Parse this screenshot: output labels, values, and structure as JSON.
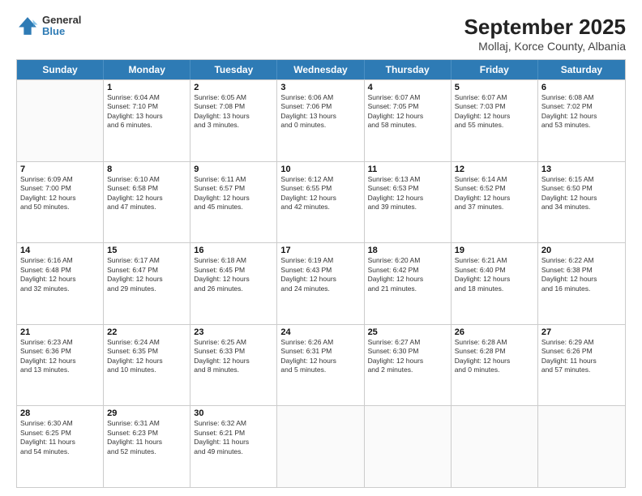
{
  "header": {
    "logo_line1": "General",
    "logo_line2": "Blue",
    "title": "September 2025",
    "subtitle": "Mollaj, Korce County, Albania"
  },
  "weekdays": [
    "Sunday",
    "Monday",
    "Tuesday",
    "Wednesday",
    "Thursday",
    "Friday",
    "Saturday"
  ],
  "weeks": [
    [
      {
        "day": "",
        "detail": ""
      },
      {
        "day": "1",
        "detail": "Sunrise: 6:04 AM\nSunset: 7:10 PM\nDaylight: 13 hours\nand 6 minutes."
      },
      {
        "day": "2",
        "detail": "Sunrise: 6:05 AM\nSunset: 7:08 PM\nDaylight: 13 hours\nand 3 minutes."
      },
      {
        "day": "3",
        "detail": "Sunrise: 6:06 AM\nSunset: 7:06 PM\nDaylight: 13 hours\nand 0 minutes."
      },
      {
        "day": "4",
        "detail": "Sunrise: 6:07 AM\nSunset: 7:05 PM\nDaylight: 12 hours\nand 58 minutes."
      },
      {
        "day": "5",
        "detail": "Sunrise: 6:07 AM\nSunset: 7:03 PM\nDaylight: 12 hours\nand 55 minutes."
      },
      {
        "day": "6",
        "detail": "Sunrise: 6:08 AM\nSunset: 7:02 PM\nDaylight: 12 hours\nand 53 minutes."
      }
    ],
    [
      {
        "day": "7",
        "detail": "Sunrise: 6:09 AM\nSunset: 7:00 PM\nDaylight: 12 hours\nand 50 minutes."
      },
      {
        "day": "8",
        "detail": "Sunrise: 6:10 AM\nSunset: 6:58 PM\nDaylight: 12 hours\nand 47 minutes."
      },
      {
        "day": "9",
        "detail": "Sunrise: 6:11 AM\nSunset: 6:57 PM\nDaylight: 12 hours\nand 45 minutes."
      },
      {
        "day": "10",
        "detail": "Sunrise: 6:12 AM\nSunset: 6:55 PM\nDaylight: 12 hours\nand 42 minutes."
      },
      {
        "day": "11",
        "detail": "Sunrise: 6:13 AM\nSunset: 6:53 PM\nDaylight: 12 hours\nand 39 minutes."
      },
      {
        "day": "12",
        "detail": "Sunrise: 6:14 AM\nSunset: 6:52 PM\nDaylight: 12 hours\nand 37 minutes."
      },
      {
        "day": "13",
        "detail": "Sunrise: 6:15 AM\nSunset: 6:50 PM\nDaylight: 12 hours\nand 34 minutes."
      }
    ],
    [
      {
        "day": "14",
        "detail": "Sunrise: 6:16 AM\nSunset: 6:48 PM\nDaylight: 12 hours\nand 32 minutes."
      },
      {
        "day": "15",
        "detail": "Sunrise: 6:17 AM\nSunset: 6:47 PM\nDaylight: 12 hours\nand 29 minutes."
      },
      {
        "day": "16",
        "detail": "Sunrise: 6:18 AM\nSunset: 6:45 PM\nDaylight: 12 hours\nand 26 minutes."
      },
      {
        "day": "17",
        "detail": "Sunrise: 6:19 AM\nSunset: 6:43 PM\nDaylight: 12 hours\nand 24 minutes."
      },
      {
        "day": "18",
        "detail": "Sunrise: 6:20 AM\nSunset: 6:42 PM\nDaylight: 12 hours\nand 21 minutes."
      },
      {
        "day": "19",
        "detail": "Sunrise: 6:21 AM\nSunset: 6:40 PM\nDaylight: 12 hours\nand 18 minutes."
      },
      {
        "day": "20",
        "detail": "Sunrise: 6:22 AM\nSunset: 6:38 PM\nDaylight: 12 hours\nand 16 minutes."
      }
    ],
    [
      {
        "day": "21",
        "detail": "Sunrise: 6:23 AM\nSunset: 6:36 PM\nDaylight: 12 hours\nand 13 minutes."
      },
      {
        "day": "22",
        "detail": "Sunrise: 6:24 AM\nSunset: 6:35 PM\nDaylight: 12 hours\nand 10 minutes."
      },
      {
        "day": "23",
        "detail": "Sunrise: 6:25 AM\nSunset: 6:33 PM\nDaylight: 12 hours\nand 8 minutes."
      },
      {
        "day": "24",
        "detail": "Sunrise: 6:26 AM\nSunset: 6:31 PM\nDaylight: 12 hours\nand 5 minutes."
      },
      {
        "day": "25",
        "detail": "Sunrise: 6:27 AM\nSunset: 6:30 PM\nDaylight: 12 hours\nand 2 minutes."
      },
      {
        "day": "26",
        "detail": "Sunrise: 6:28 AM\nSunset: 6:28 PM\nDaylight: 12 hours\nand 0 minutes."
      },
      {
        "day": "27",
        "detail": "Sunrise: 6:29 AM\nSunset: 6:26 PM\nDaylight: 11 hours\nand 57 minutes."
      }
    ],
    [
      {
        "day": "28",
        "detail": "Sunrise: 6:30 AM\nSunset: 6:25 PM\nDaylight: 11 hours\nand 54 minutes."
      },
      {
        "day": "29",
        "detail": "Sunrise: 6:31 AM\nSunset: 6:23 PM\nDaylight: 11 hours\nand 52 minutes."
      },
      {
        "day": "30",
        "detail": "Sunrise: 6:32 AM\nSunset: 6:21 PM\nDaylight: 11 hours\nand 49 minutes."
      },
      {
        "day": "",
        "detail": ""
      },
      {
        "day": "",
        "detail": ""
      },
      {
        "day": "",
        "detail": ""
      },
      {
        "day": "",
        "detail": ""
      }
    ]
  ]
}
